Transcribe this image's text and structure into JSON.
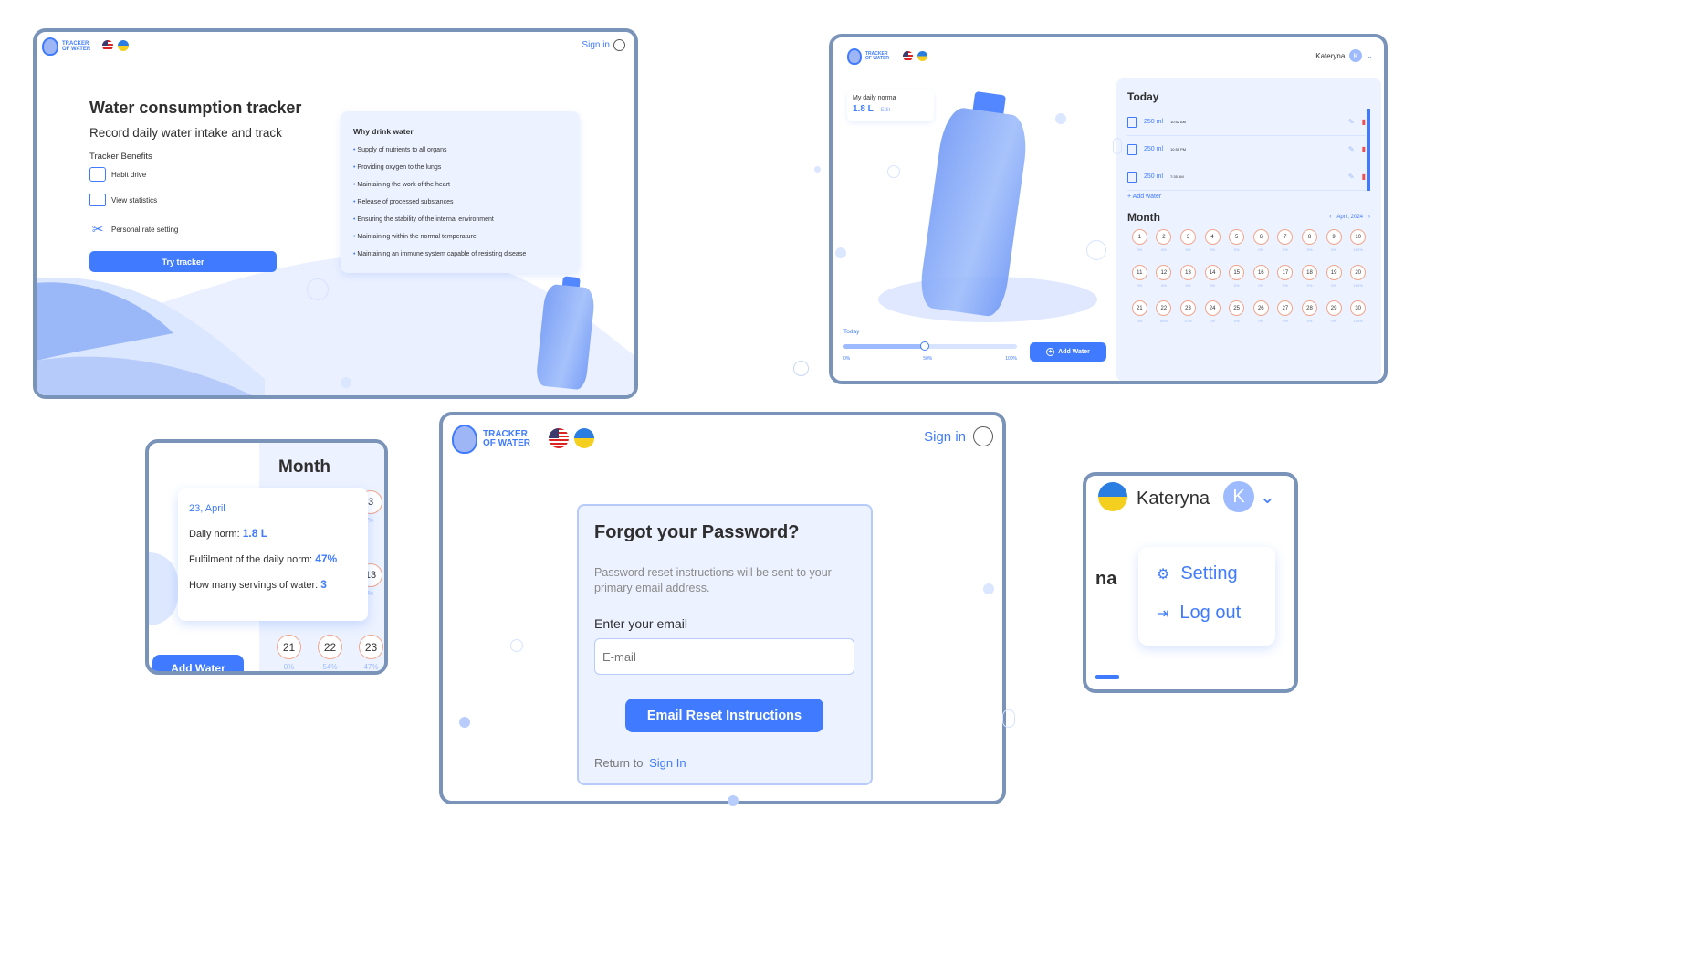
{
  "brand": {
    "line1": "TRACKER",
    "line2": "OF WATER"
  },
  "home": {
    "sign_in": "Sign in",
    "title": "Water consumption tracker",
    "subtitle": "Record daily water intake and track",
    "benefits_title": "Tracker Benefits",
    "benefits": [
      "Habit drive",
      "View statistics",
      "Personal rate setting"
    ],
    "cta": "Try tracker",
    "why_title": "Why drink water",
    "why_items": [
      "Supply of nutrients to all organs",
      "Providing oxygen to the lungs",
      "Maintaining the work of the heart",
      "Release of processed substances",
      "Ensuring the stability of the internal environment",
      "Maintaining within the normal temperature",
      "Maintaining an immune system capable of resisting disease"
    ]
  },
  "dashboard": {
    "user_name": "Kateryna",
    "avatar_letter": "K",
    "norma_label": "My daily norma",
    "norma_value": "1.8 L",
    "edit": "Edit",
    "today_title": "Today",
    "entries": [
      {
        "amount": "250 ml",
        "time": "10:52 AM"
      },
      {
        "amount": "250 ml",
        "time": "10:55 PM"
      },
      {
        "amount": "250 ml",
        "time": "7:35 AM"
      }
    ],
    "add_water_link": "Add water",
    "month_title": "Month",
    "month_label": "April, 2024",
    "days": [
      {
        "n": "1",
        "p": "0%"
      },
      {
        "n": "2",
        "p": "0%"
      },
      {
        "n": "3",
        "p": "0%"
      },
      {
        "n": "4",
        "p": "0%"
      },
      {
        "n": "5",
        "p": "0%"
      },
      {
        "n": "6",
        "p": "0%"
      },
      {
        "n": "7",
        "p": "0%"
      },
      {
        "n": "8",
        "p": "0%"
      },
      {
        "n": "9",
        "p": "0%"
      },
      {
        "n": "10",
        "p": "100%"
      },
      {
        "n": "11",
        "p": "0%"
      },
      {
        "n": "12",
        "p": "0%"
      },
      {
        "n": "13",
        "p": "0%"
      },
      {
        "n": "14",
        "p": "0%"
      },
      {
        "n": "15",
        "p": "0%"
      },
      {
        "n": "16",
        "p": "0%"
      },
      {
        "n": "17",
        "p": "0%"
      },
      {
        "n": "18",
        "p": "0%"
      },
      {
        "n": "19",
        "p": "0%"
      },
      {
        "n": "20",
        "p": "100%"
      },
      {
        "n": "21",
        "p": "0%"
      },
      {
        "n": "22",
        "p": "54%"
      },
      {
        "n": "23",
        "p": "47%"
      },
      {
        "n": "24",
        "p": "0%"
      },
      {
        "n": "25",
        "p": "0%"
      },
      {
        "n": "26",
        "p": "0%"
      },
      {
        "n": "27",
        "p": "0%"
      },
      {
        "n": "28",
        "p": "0%"
      },
      {
        "n": "29",
        "p": "0%"
      },
      {
        "n": "30",
        "p": "100%"
      }
    ],
    "today_label": "Today",
    "progress": 0.47,
    "scale": [
      "0%",
      "50%",
      "100%"
    ],
    "add_water_btn": "Add Water"
  },
  "month_popup": {
    "title": "Month",
    "date": "23, April",
    "norm_label": "Daily norm:",
    "norm_value": "1.8 L",
    "fulfil_label": "Fulfilment of the daily norm:",
    "fulfil_value": "47%",
    "servings_label": "How many servings of water:",
    "servings_value": "3",
    "right_days": [
      "3",
      "13"
    ],
    "right_pcts": [
      "0%",
      "0%"
    ],
    "days": [
      {
        "n": "21",
        "p": "0%"
      },
      {
        "n": "22",
        "p": "54%"
      },
      {
        "n": "23",
        "p": "47%"
      }
    ],
    "add_water": "Add Water"
  },
  "forgot": {
    "sign_in": "Sign in",
    "title": "Forgot your Password?",
    "desc": "Password reset instructions will be sent to your primary email address.",
    "email_label": "Enter your email",
    "email_placeholder": "E-mail",
    "button": "Email Reset Instructions",
    "return_text": "Return to",
    "return_link": "Sign In"
  },
  "user_menu": {
    "name": "Kateryna",
    "avatar": "K",
    "partial": "na",
    "setting": "Setting",
    "logout": "Log out"
  }
}
